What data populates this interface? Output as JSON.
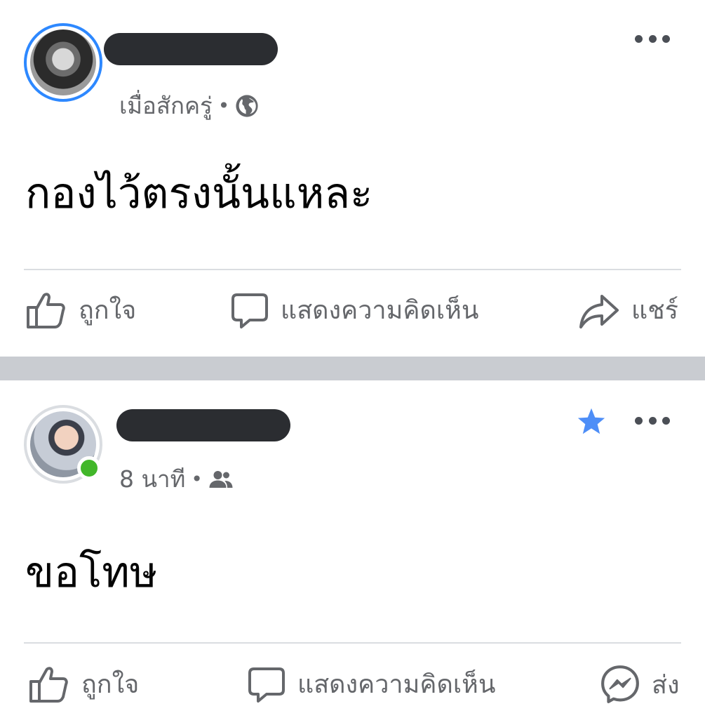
{
  "posts": [
    {
      "timestamp": "เมื่อสักครู่",
      "audience_icon": "globe-icon",
      "text": "กองไว้ตรงนั้นแหละ",
      "actions": {
        "like": "ถูกใจ",
        "comment": "แสดงความคิดเห็น",
        "share": "แชร์"
      }
    },
    {
      "timestamp": "8 นาที",
      "audience_icon": "friends-icon",
      "text": "ขอโทษ",
      "favorite_icon": "star-icon",
      "online": true,
      "actions": {
        "like": "ถูกใจ",
        "comment": "แสดงความคิดเห็น",
        "send": "ส่ง"
      }
    }
  ],
  "colors": {
    "story_ring": "#2d88ff",
    "online_dot": "#42b72a",
    "star": "#4e8ef7",
    "secondary_text": "#65676b",
    "separator": "#c9ccd1"
  }
}
